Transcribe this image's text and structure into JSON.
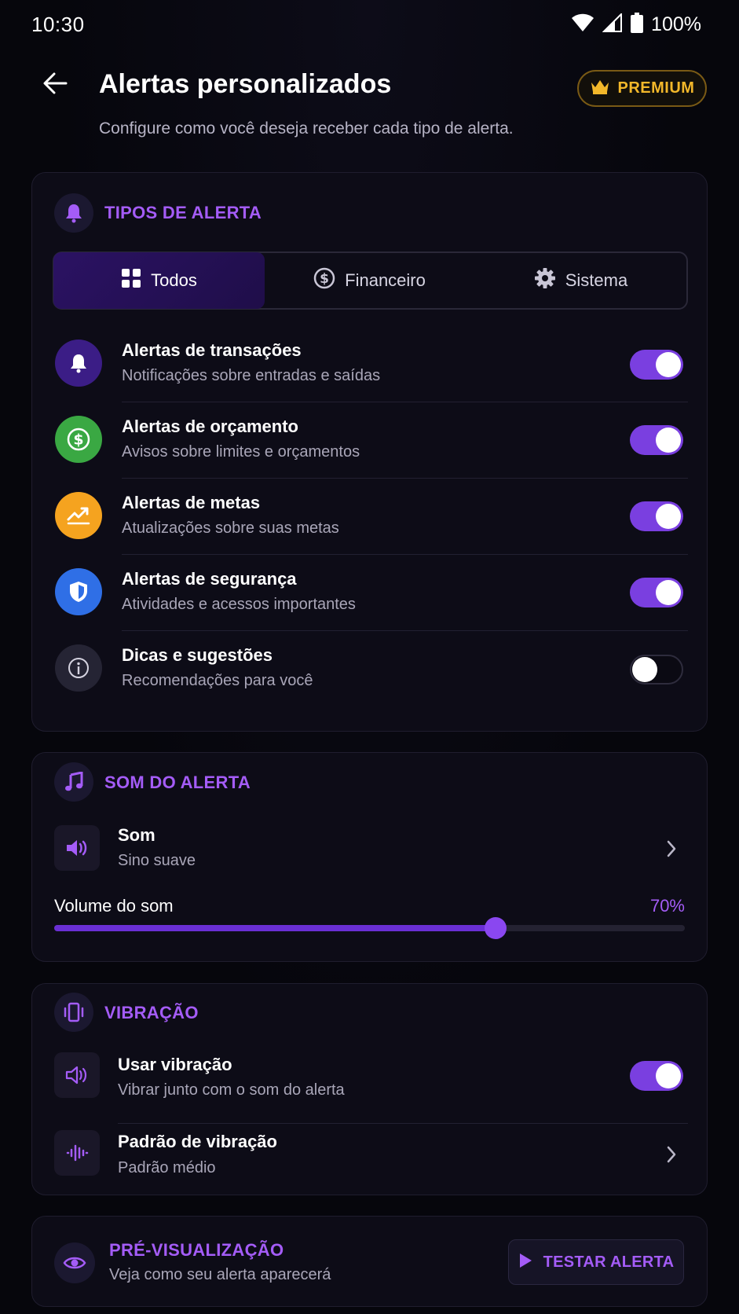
{
  "status_bar": {
    "time": "10:30",
    "battery": "100%",
    "icons": [
      "wifi-icon",
      "signal-icon",
      "battery-icon"
    ]
  },
  "header": {
    "title": "Alertas personalizados",
    "subtitle": "Configure como você deseja receber cada tipo de alerta.",
    "premium_label": "PREMIUM",
    "premium_icon": "crown-icon",
    "back_icon": "arrow-left-icon"
  },
  "alert_types": {
    "section_title": "TIPOS DE ALERTA",
    "section_icon": "bell-icon",
    "tabs": [
      {
        "label": "Todos",
        "icon": "grid-icon",
        "active": true
      },
      {
        "label": "Financeiro",
        "icon": "dollar-circle-icon",
        "active": false
      },
      {
        "label": "Sistema",
        "icon": "gear-icon",
        "active": false
      }
    ],
    "items": [
      {
        "title": "Alertas de transações",
        "subtitle": "Notificações sobre entradas e saídas",
        "icon": "bell-icon",
        "color": "#3b1d86",
        "enabled": true
      },
      {
        "title": "Alertas de orçamento",
        "subtitle": "Avisos sobre limites e orçamentos",
        "icon": "dollar-circle-icon",
        "color": "#3aa843",
        "enabled": true
      },
      {
        "title": "Alertas de metas",
        "subtitle": "Atualizações sobre suas metas",
        "icon": "trending-up-icon",
        "color": "#f5a31f",
        "enabled": true
      },
      {
        "title": "Alertas de segurança",
        "subtitle": "Atividades e acessos importantes",
        "icon": "shield-icon",
        "color": "#2f6fe6",
        "enabled": true
      },
      {
        "title": "Dicas e sugestões",
        "subtitle": "Recomendações para você",
        "icon": "info-icon",
        "color": "#252434",
        "enabled": false
      }
    ]
  },
  "sound": {
    "section_title": "SOM DO ALERTA",
    "section_icon": "music-note-icon",
    "sound_label": "Som",
    "sound_value": "Sino suave",
    "volume_label": "Volume do som",
    "volume_value": "70%",
    "volume_fraction": 0.7
  },
  "vibration": {
    "section_title": "VIBRAÇÃO",
    "section_icon": "phone-vibrate-icon",
    "use_label": "Usar vibração",
    "use_sub": "Vibrar junto com o som do alerta",
    "use_enabled": true,
    "pattern_label": "Padrão de vibração",
    "pattern_value": "Padrão médio"
  },
  "preview": {
    "section_title": "PRÉ-VISUALIZAÇÃO",
    "section_icon": "eye-icon",
    "subtitle": "Veja como seu alerta aparecerá",
    "button_label": "TESTAR ALERTA",
    "button_icon": "play-icon"
  },
  "colors": {
    "accent": "#a45cf7",
    "toggle_on": "#7a3fe0",
    "premium": "#f2b72a",
    "background": "#06060c",
    "card": "#0d0c17"
  }
}
